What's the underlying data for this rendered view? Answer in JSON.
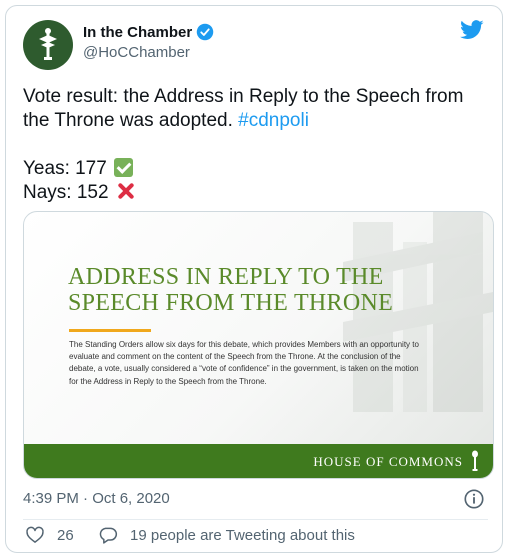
{
  "author": {
    "display_name": "In the Chamber",
    "handle": "@HoCChamber",
    "verified": true
  },
  "tweet": {
    "text_line1": "Vote result: the Address in Reply to the Speech from",
    "text_line2": "the Throne was adopted. ",
    "hashtag": "#cdnpoli",
    "yeas": "Yeas: 177",
    "nays": "Nays: 152",
    "timestamp": "4:39 PM · Oct 6, 2020"
  },
  "card": {
    "title_line1": "ADDRESS IN REPLY TO THE",
    "title_line2": "SPEECH FROM THE THRONE",
    "body": "The Standing Orders allow six days for this debate, which provides Members with an opportunity to evaluate and comment on the content of the Speech from the Throne. At the conclusion of the debate, a vote, usually considered a “vote of confidence” in the government, is taken on the motion for the Address in Reply to the Speech from the Throne.",
    "footer": "HOUSE OF COMMONS"
  },
  "actions": {
    "likes": "26",
    "tweeting": "19 people are Tweeting about this"
  },
  "colors": {
    "twitter_blue": "#1d9bf0",
    "card_green": "#3f7a1e",
    "title_green": "#5a8a2a",
    "accent_orange": "#f0a81c"
  },
  "icons": [
    "hoc-logo-icon",
    "verified-icon",
    "twitter-bird-icon",
    "check-mark-emoji",
    "cross-mark-emoji",
    "mace-icon",
    "info-icon",
    "heart-icon",
    "reply-bubble-icon"
  ]
}
